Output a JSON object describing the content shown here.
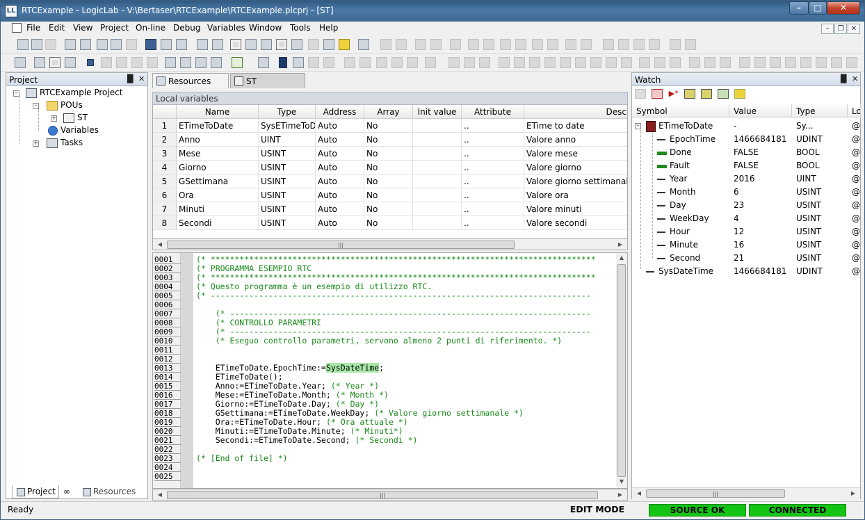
{
  "window": {
    "title": "RTCExample - LogicLab - V:\\Bertaser\\RTCExample\\RTCExample.plcprj - [ST]"
  },
  "menu": [
    "File",
    "Edit",
    "View",
    "Project",
    "On-line",
    "Debug",
    "Variables",
    "Window",
    "Tools",
    "Help"
  ],
  "project_pane": {
    "title": "Project",
    "tree": {
      "root": "RTCExample Project",
      "pous": "POUs",
      "st": "ST",
      "variables": "Variables",
      "tasks": "Tasks"
    },
    "tabs": {
      "project": "Project",
      "resources": "Resources"
    }
  },
  "doc_tabs": {
    "resources": "Resources",
    "st": "ST"
  },
  "local_vars": {
    "header": "Local variables",
    "columns": [
      "Name",
      "Type",
      "Address",
      "Array",
      "Init value",
      "Attribute",
      "Desc"
    ],
    "rows": [
      {
        "n": "1",
        "name": "ETimeToDate",
        "type": "SysETimeToD",
        "address": "Auto",
        "array": "No",
        "init": "",
        "attr": "..",
        "desc": "ETime to date"
      },
      {
        "n": "2",
        "name": "Anno",
        "type": "UINT",
        "address": "Auto",
        "array": "No",
        "init": "",
        "attr": "..",
        "desc": "Valore anno"
      },
      {
        "n": "3",
        "name": "Mese",
        "type": "USINT",
        "address": "Auto",
        "array": "No",
        "init": "",
        "attr": "..",
        "desc": "Valore mese"
      },
      {
        "n": "4",
        "name": "Giorno",
        "type": "USINT",
        "address": "Auto",
        "array": "No",
        "init": "",
        "attr": "..",
        "desc": "Valore giorno"
      },
      {
        "n": "5",
        "name": "GSettimana",
        "type": "USINT",
        "address": "Auto",
        "array": "No",
        "init": "",
        "attr": "..",
        "desc": "Valore giorno settimanale"
      },
      {
        "n": "6",
        "name": "Ora",
        "type": "USINT",
        "address": "Auto",
        "array": "No",
        "init": "",
        "attr": "..",
        "desc": "Valore ora"
      },
      {
        "n": "7",
        "name": "Minuti",
        "type": "USINT",
        "address": "Auto",
        "array": "No",
        "init": "",
        "attr": "..",
        "desc": "Valore minuti"
      },
      {
        "n": "8",
        "name": "Secondi",
        "type": "USINT",
        "address": "Auto",
        "array": "No",
        "init": "",
        "attr": "..",
        "desc": "Valore secondi"
      }
    ]
  },
  "editor": {
    "lines": [
      {
        "n": "0001",
        "code": "(* ********************************************************************************"
      },
      {
        "n": "0002",
        "code": "(* PROGRAMMA ESEMPIO RTC"
      },
      {
        "n": "0003",
        "code": "(* ********************************************************************************"
      },
      {
        "n": "0004",
        "code": "(* Questo programma è un esempio di utilizzo RTC."
      },
      {
        "n": "0005",
        "code": "(* -------------------------------------------------------------------------------"
      },
      {
        "n": "0006",
        "code": ""
      },
      {
        "n": "0007",
        "code": "    (* ---------------------------------------------------------------------------"
      },
      {
        "n": "0008",
        "code": "    (* CONTROLLO PARAMETRI"
      },
      {
        "n": "0009",
        "code": "    (* ---------------------------------------------------------------------------"
      },
      {
        "n": "0010",
        "code": "    (* Eseguo controllo parametri, servono almeno 2 punti di riferimento. *)"
      },
      {
        "n": "0011",
        "code": ""
      },
      {
        "n": "0012",
        "code": ""
      },
      {
        "n": "0013",
        "code": "    ETimeToDate.EpochTime:=",
        "highlight": "SysDateTime",
        "after": ";"
      },
      {
        "n": "0014",
        "code": "    ETimeToDate();"
      },
      {
        "n": "0015",
        "code": "    Anno:=ETimeToDate.Year; ",
        "comment": "(* Year *)"
      },
      {
        "n": "0016",
        "code": "    Mese:=ETimeToDate.Month; ",
        "comment": "(* Month *)"
      },
      {
        "n": "0017",
        "code": "    Giorno:=ETimeToDate.Day; ",
        "comment": "(* Day *)"
      },
      {
        "n": "0018",
        "code": "    GSettimana:=ETimeToDate.WeekDay; ",
        "comment": "(* Valore giorno settimanale *)"
      },
      {
        "n": "0019",
        "code": "    Ora:=ETimeToDate.Hour; ",
        "comment": "(* Ora attuale *)"
      },
      {
        "n": "0020",
        "code": "    Minuti:=ETimeToDate.Minute; ",
        "comment": "(* Minuti*)"
      },
      {
        "n": "0021",
        "code": "    Secondi:=ETimeToDate.Second; ",
        "comment": "(* Secondi *)"
      },
      {
        "n": "0022",
        "code": ""
      },
      {
        "n": "0023",
        "code": "(* [End of file] *)"
      },
      {
        "n": "0024",
        "code": ""
      },
      {
        "n": "0025",
        "code": ""
      }
    ]
  },
  "watch": {
    "title": "Watch",
    "columns": [
      "Symbol",
      "Value",
      "Type",
      "Lo"
    ],
    "root": {
      "symbol": "ETimeToDate",
      "value": "-",
      "type": "Sy...",
      "loc": "@"
    },
    "children": [
      {
        "symbol": "EpochTime",
        "value": "1466684181",
        "type": "UDINT",
        "loc": "@",
        "marker": "dash"
      },
      {
        "symbol": "Done",
        "value": "FALSE",
        "type": "BOOL",
        "loc": "@",
        "marker": "green"
      },
      {
        "symbol": "Fault",
        "value": "FALSE",
        "type": "BOOL",
        "loc": "@",
        "marker": "green"
      },
      {
        "symbol": "Year",
        "value": "2016",
        "type": "UINT",
        "loc": "@",
        "marker": "dash"
      },
      {
        "symbol": "Month",
        "value": "6",
        "type": "USINT",
        "loc": "@",
        "marker": "dash"
      },
      {
        "symbol": "Day",
        "value": "23",
        "type": "USINT",
        "loc": "@",
        "marker": "dash"
      },
      {
        "symbol": "WeekDay",
        "value": "4",
        "type": "USINT",
        "loc": "@",
        "marker": "dash"
      },
      {
        "symbol": "Hour",
        "value": "12",
        "type": "USINT",
        "loc": "@",
        "marker": "dash"
      },
      {
        "symbol": "Minute",
        "value": "16",
        "type": "USINT",
        "loc": "@",
        "marker": "dash"
      },
      {
        "symbol": "Second",
        "value": "21",
        "type": "USINT",
        "loc": "@",
        "marker": "dash"
      }
    ],
    "sys": {
      "symbol": "SysDateTime",
      "value": "1466684181",
      "type": "UDINT",
      "loc": "@"
    }
  },
  "status": {
    "ready": "Ready",
    "mode": "EDIT MODE",
    "source": "SOURCE OK",
    "connection": "CONNECTED"
  }
}
